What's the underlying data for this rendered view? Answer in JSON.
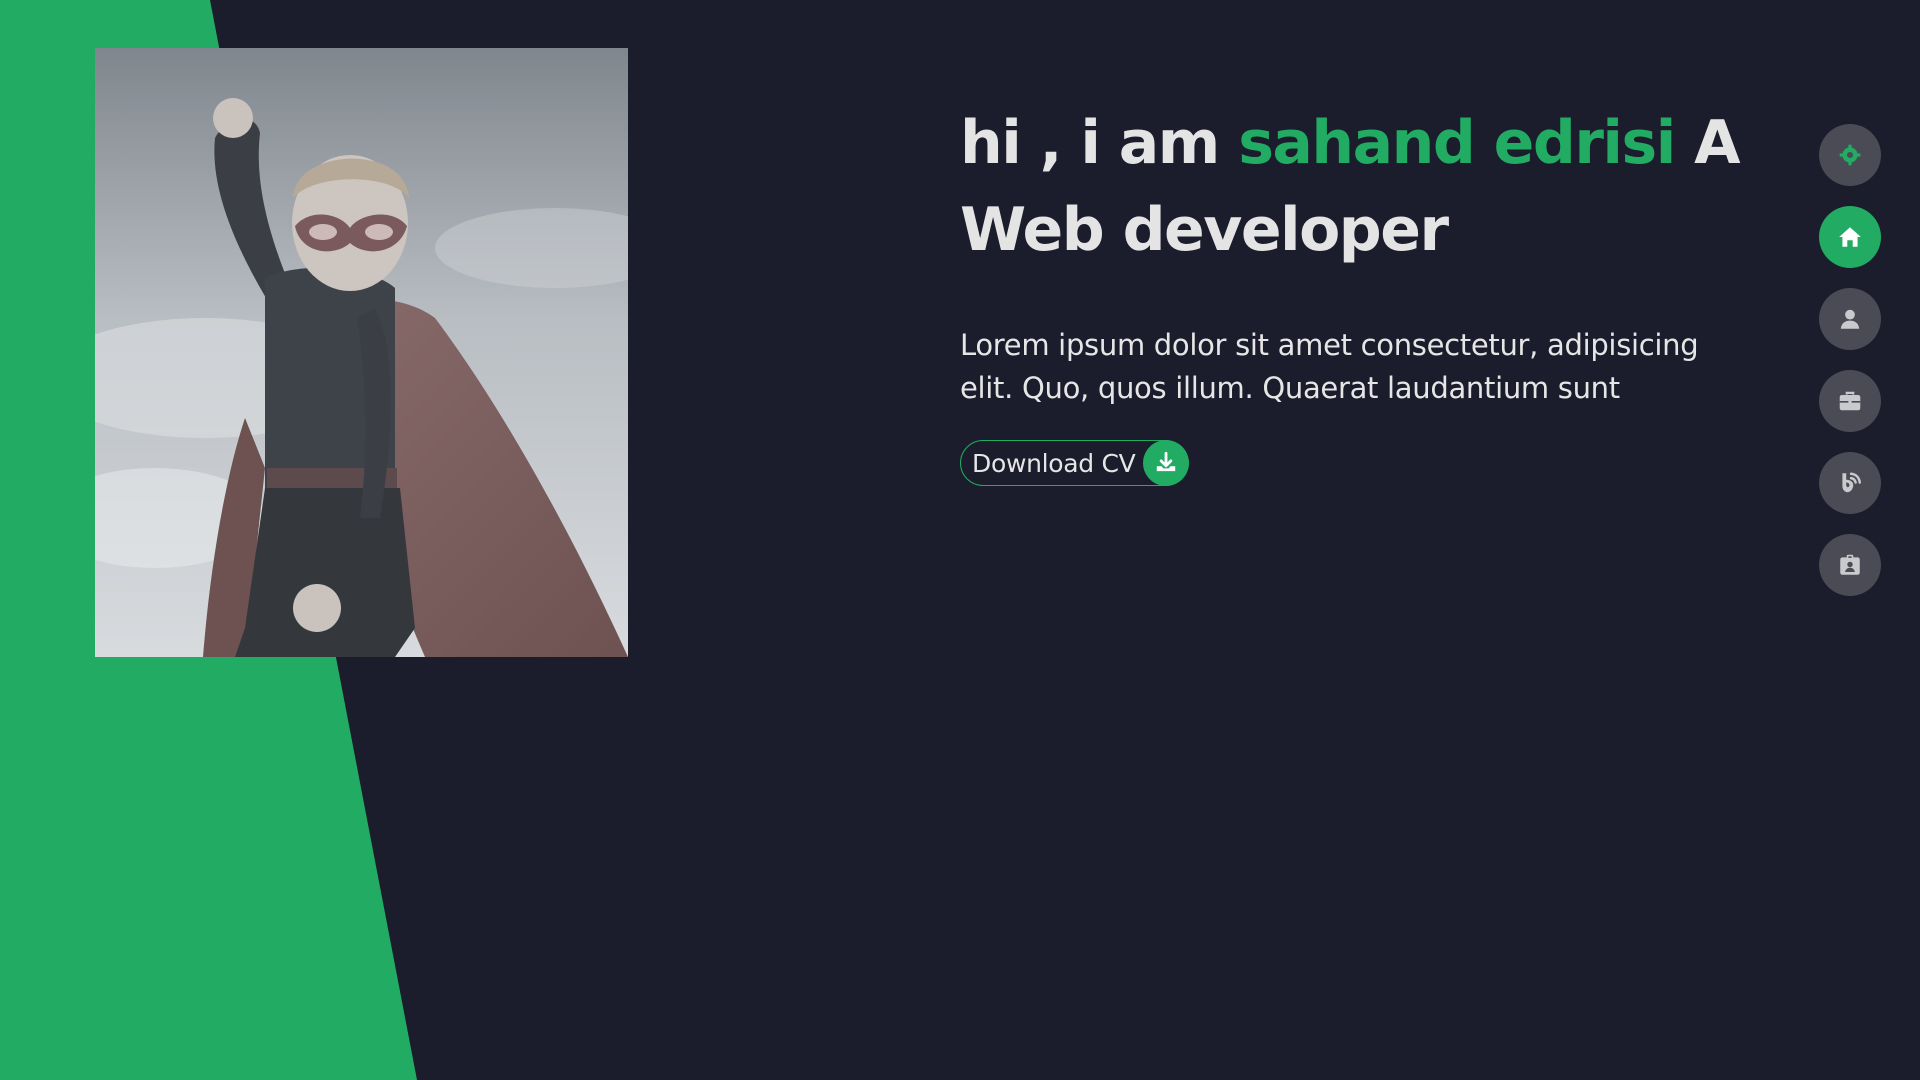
{
  "colors": {
    "background": "#1b1c2c",
    "accent": "#22ab62",
    "text": "#e4e4e4",
    "nav_inactive": "#4a4b55",
    "nav_icon_inactive": "#c9cacd"
  },
  "hero": {
    "greeting": "hi , i am",
    "name": "sahand edrisi",
    "role": "A Web developer",
    "description": "Lorem ipsum dolor sit amet consectetur, adipisicing elit. Quo, quos illum. Quaerat laudantium sunt",
    "cv_button_label": "Download CV",
    "cv_button_icon": "download-icon"
  },
  "profile_image": {
    "subject": "child in superhero mask and cape"
  },
  "side_nav": {
    "items": [
      {
        "icon": "settings-icon",
        "active": false
      },
      {
        "icon": "home-icon",
        "active": true
      },
      {
        "icon": "user-icon",
        "active": false
      },
      {
        "icon": "briefcase-icon",
        "active": false
      },
      {
        "icon": "blog-icon",
        "active": false
      },
      {
        "icon": "contact-card-icon",
        "active": false
      }
    ]
  }
}
